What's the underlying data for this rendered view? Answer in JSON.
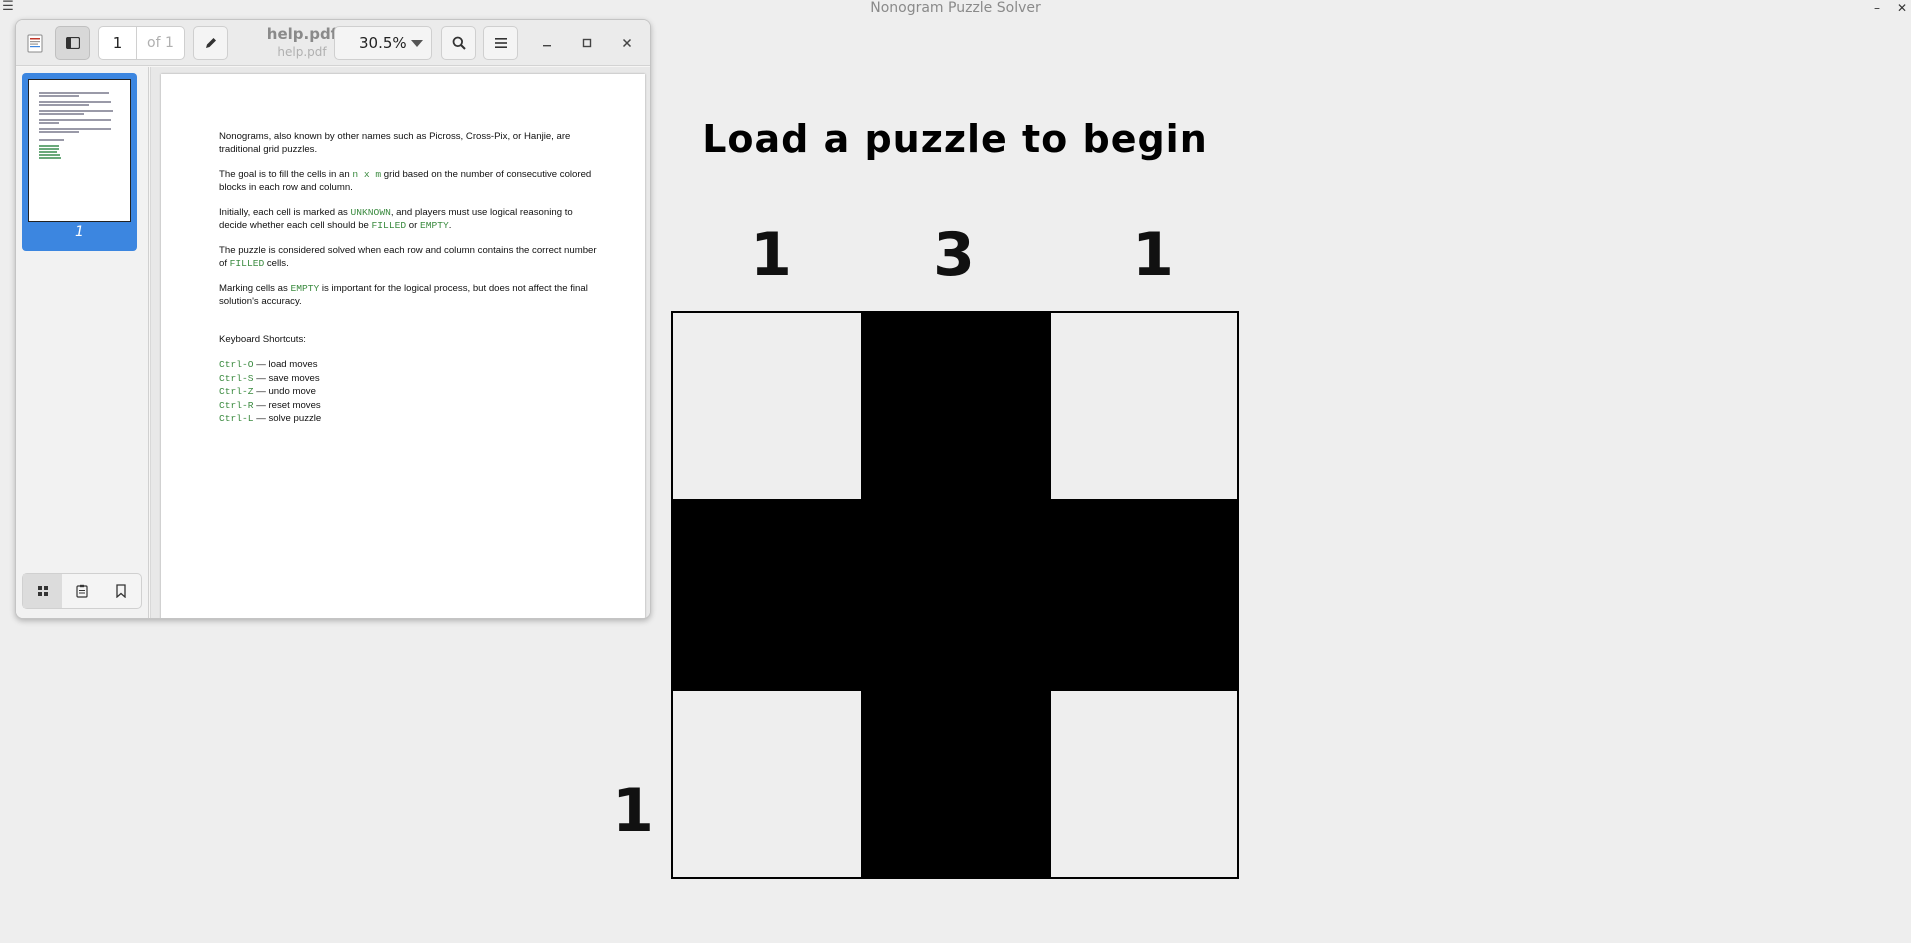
{
  "main_window": {
    "title": "Nonogram Puzzle Solver",
    "menu_icon": "hamburger-icon",
    "minimize_glyph": "–",
    "close_glyph": "✕"
  },
  "puzzle": {
    "heading": "Load a puzzle to begin",
    "column_clues": [
      "1",
      "3",
      "1"
    ],
    "row_clues": [
      "",
      "",
      "1"
    ],
    "grid": [
      [
        0,
        1,
        0
      ],
      [
        1,
        1,
        1
      ],
      [
        0,
        1,
        0
      ]
    ]
  },
  "viewer": {
    "page_current": "1",
    "page_of": "of 1",
    "doc_title": "help.pdf",
    "doc_subtitle": "help.pdf",
    "zoom": "30.5%",
    "thumbnail_label": "1",
    "document": {
      "p1": "Nonograms, also known by other names such as Picross, Cross-Pix, or Hanjie, are traditional grid puzzles.",
      "p2_a": "The goal is to fill the cells in an ",
      "p2_code": "n x m",
      "p2_b": " grid based on the number of consecutive colored blocks in each row and column.",
      "p3_a": "Initially, each cell is marked as ",
      "p3_code1": "UNKNOWN",
      "p3_b": ", and players must use logical reasoning to decide whether each cell should be ",
      "p3_code2": "FILLED",
      "p3_c": " or ",
      "p3_code3": "EMPTY",
      "p3_d": ".",
      "p4_a": "The puzzle is considered solved when each row and column contains the correct number of ",
      "p4_code": "FILLED",
      "p4_b": " cells.",
      "p5_a": "Marking cells as ",
      "p5_code": "EMPTY",
      "p5_b": " is important for the logical process, but does not affect the final solution's accuracy.",
      "shortcuts_heading": "Keyboard Shortcuts:",
      "shortcuts": [
        {
          "key": "Ctrl-O",
          "desc": " — load moves"
        },
        {
          "key": "Ctrl-S",
          "desc": " — save moves"
        },
        {
          "key": "Ctrl-Z",
          "desc": " — undo move"
        },
        {
          "key": "Ctrl-R",
          "desc": " — reset moves"
        },
        {
          "key": "Ctrl-L",
          "desc": " — solve puzzle"
        }
      ]
    }
  }
}
